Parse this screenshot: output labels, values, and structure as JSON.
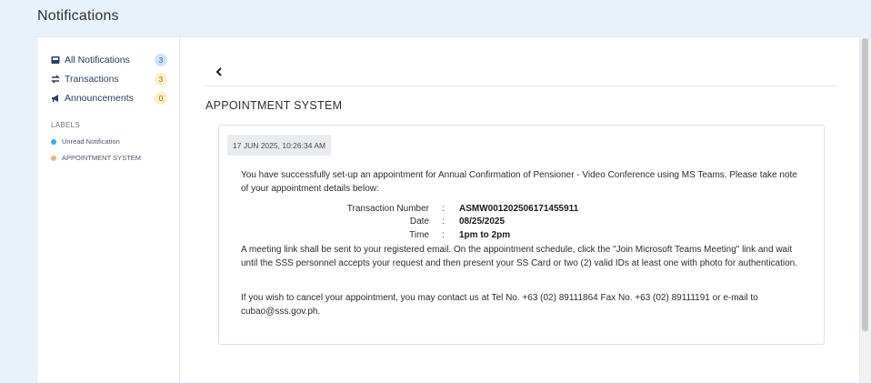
{
  "page": {
    "title": "Notifications"
  },
  "sidebar": {
    "items": [
      {
        "label": "All Notifications",
        "count": "3",
        "icon": "inbox-icon"
      },
      {
        "label": "Transactions",
        "count": "3",
        "icon": "exchange-icon"
      },
      {
        "label": "Announcements",
        "count": "0",
        "icon": "megaphone-icon"
      }
    ],
    "labels_heading": "LABELS",
    "labels": [
      {
        "text": "Unread Notification",
        "color": "#29b6e0"
      },
      {
        "text": "APPOINTMENT SYSTEM",
        "color": "#f2b48a"
      }
    ]
  },
  "content": {
    "back_icon": "chevron-left-icon",
    "section_title": "APPOINTMENT SYSTEM",
    "card": {
      "timestamp": "17 JUN 2025, 10:26:34 AM",
      "intro": "You have successfully set-up an appointment for Annual Confirmation of Pensioner - Video Conference using MS Teams. Please take note of your appointment details below:",
      "details": [
        {
          "key": "Transaction Number",
          "sep": ":",
          "value": "ASMW001202506171455911"
        },
        {
          "key": "Date",
          "sep": ":",
          "value": "08/25/2025"
        },
        {
          "key": "Time",
          "sep": ":",
          "value": "1pm to 2pm"
        }
      ],
      "meeting_note": "A meeting link shall be sent to your registered email. On the appointment schedule, click the \"Join Microsoft Teams Meeting\" link and wait until the SSS personnel accepts your request and then present your SS Card or two (2) valid IDs at least one with photo for authentication.",
      "cancel_note": "If you wish to cancel your appointment, you may contact us at Tel No. +63 (02) 89111864 Fax No. +63 (02) 89111191 or e-mail to cubao@sss.gov.ph."
    }
  },
  "colors": {
    "accent": "#2c3f63",
    "background": "#e8f2fb"
  }
}
